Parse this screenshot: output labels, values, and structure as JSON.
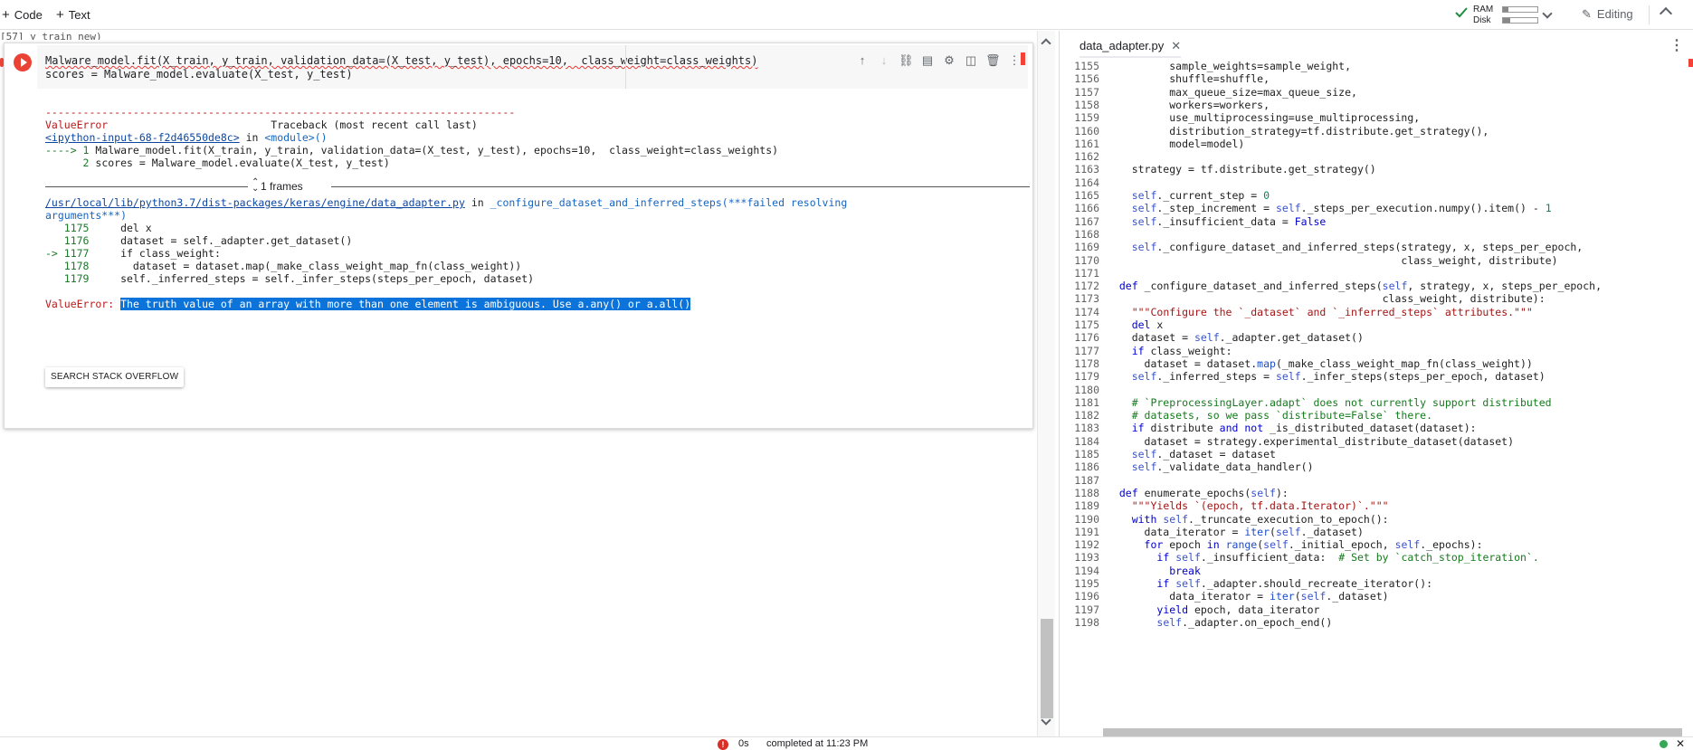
{
  "toolbar": {
    "code_label": "Code",
    "text_label": "Text",
    "ram_label": "RAM",
    "disk_label": "Disk",
    "ram_fill": 0.15,
    "disk_fill": 0.2,
    "editing_label": "Editing"
  },
  "notebook": {
    "prev_cell_fragment": "[57]                                                    y_train_new)",
    "code_lines": [
      "Malware_model.fit(X_train, y_train, validation_data=(X_test, y_test), epochs=10,  class_weight=class_weights)",
      "scores = Malware_model.evaluate(X_test, y_test)"
    ],
    "output": {
      "dashes": "---------------------------------------------------------------------------",
      "error_name": "ValueError",
      "traceback_header": "Traceback (most recent call last)",
      "input_link": "<ipython-input-68-f2d46550de8c>",
      "in_text": " in ",
      "module_text": "<module>()",
      "arrow_line_prefix": "----> 1 ",
      "arrow_line_code": "Malware_model.fit(X_train, y_train, validation_data=(X_test, y_test), epochs=10,  class_weight=class_weights)",
      "line2_prefix": "      2 ",
      "line2_code": "scores = Malware_model.evaluate(X_test, y_test)",
      "frames_label": "1 frames",
      "file_link": "/usr/local/lib/python3.7/dist-packages/keras/engine/data_adapter.py",
      "func_name": "_configure_dataset_and_inferred_steps(***failed resolving",
      "func_name_cont": "arguments***)",
      "frame_lines": [
        {
          "prefix": "   1175 ",
          "code": "    del x"
        },
        {
          "prefix": "   1176 ",
          "code": "    dataset = self._adapter.get_dataset()"
        },
        {
          "prefix": "-> 1177 ",
          "code": "    if class_weight:"
        },
        {
          "prefix": "   1178 ",
          "code": "      dataset = dataset.map(_make_class_weight_map_fn(class_weight))"
        },
        {
          "prefix": "   1179 ",
          "code": "    self._inferred_steps = self._infer_steps(steps_per_epoch, dataset)"
        }
      ],
      "final_error_name": "ValueError:",
      "final_error_msg": "The truth value of an array with more than one element is ambiguous. Use a.any() or a.all()",
      "search_button": "SEARCH STACK OVERFLOW"
    }
  },
  "editor": {
    "tab_title": "data_adapter.py",
    "lines": [
      {
        "n": "1155",
        "t": "          sample_weights=sample_weight,"
      },
      {
        "n": "1156",
        "t": "          shuffle=shuffle,"
      },
      {
        "n": "1157",
        "t": "          max_queue_size=max_queue_size,"
      },
      {
        "n": "1158",
        "t": "          workers=workers,"
      },
      {
        "n": "1159",
        "t": "          use_multiprocessing=use_multiprocessing,"
      },
      {
        "n": "1160",
        "t": "          distribution_strategy=tf.distribute.get_strategy(),"
      },
      {
        "n": "1161",
        "t": "          model=model)"
      },
      {
        "n": "1162",
        "t": ""
      },
      {
        "n": "1163",
        "t": "    strategy = tf.distribute.get_strategy()"
      },
      {
        "n": "1164",
        "t": ""
      },
      {
        "n": "1165",
        "t": "    self._current_step = 0"
      },
      {
        "n": "1166",
        "t": "    self._step_increment = self._steps_per_execution.numpy().item() - 1"
      },
      {
        "n": "1167",
        "t": "    self._insufficient_data = False"
      },
      {
        "n": "1168",
        "t": ""
      },
      {
        "n": "1169",
        "t": "    self._configure_dataset_and_inferred_steps(strategy, x, steps_per_epoch,"
      },
      {
        "n": "1170",
        "t": "                                               class_weight, distribute)"
      },
      {
        "n": "1171",
        "t": ""
      },
      {
        "n": "1172",
        "t": "  def _configure_dataset_and_inferred_steps(self, strategy, x, steps_per_epoch,"
      },
      {
        "n": "1173",
        "t": "                                            class_weight, distribute):"
      },
      {
        "n": "1174",
        "t": "    \"\"\"Configure the `_dataset` and `_inferred_steps` attributes.\"\"\""
      },
      {
        "n": "1175",
        "t": "    del x"
      },
      {
        "n": "1176",
        "t": "    dataset = self._adapter.get_dataset()"
      },
      {
        "n": "1177",
        "t": "    if class_weight:"
      },
      {
        "n": "1178",
        "t": "      dataset = dataset.map(_make_class_weight_map_fn(class_weight))"
      },
      {
        "n": "1179",
        "t": "    self._inferred_steps = self._infer_steps(steps_per_epoch, dataset)"
      },
      {
        "n": "1180",
        "t": ""
      },
      {
        "n": "1181",
        "t": "    # `PreprocessingLayer.adapt` does not currently support distributed"
      },
      {
        "n": "1182",
        "t": "    # datasets, so we pass `distribute=False` there."
      },
      {
        "n": "1183",
        "t": "    if distribute and not _is_distributed_dataset(dataset):"
      },
      {
        "n": "1184",
        "t": "      dataset = strategy.experimental_distribute_dataset(dataset)"
      },
      {
        "n": "1185",
        "t": "    self._dataset = dataset"
      },
      {
        "n": "1186",
        "t": "    self._validate_data_handler()"
      },
      {
        "n": "1187",
        "t": ""
      },
      {
        "n": "1188",
        "t": "  def enumerate_epochs(self):"
      },
      {
        "n": "1189",
        "t": "    \"\"\"Yields `(epoch, tf.data.Iterator)`.\"\"\""
      },
      {
        "n": "1190",
        "t": "    with self._truncate_execution_to_epoch():"
      },
      {
        "n": "1191",
        "t": "      data_iterator = iter(self._dataset)"
      },
      {
        "n": "1192",
        "t": "      for epoch in range(self._initial_epoch, self._epochs):"
      },
      {
        "n": "1193",
        "t": "        if self._insufficient_data:  # Set by `catch_stop_iteration`."
      },
      {
        "n": "1194",
        "t": "          break"
      },
      {
        "n": "1195",
        "t": "        if self._adapter.should_recreate_iterator():"
      },
      {
        "n": "1196",
        "t": "          data_iterator = iter(self._dataset)"
      },
      {
        "n": "1197",
        "t": "        yield epoch, data_iterator"
      },
      {
        "n": "1198",
        "t": "        self._adapter.on_epoch_end()"
      }
    ]
  },
  "status": {
    "time": "0s",
    "completed": "completed at 11:23 PM"
  },
  "colors": {
    "accent_red": "#ea4335",
    "selection_blue": "#0b73d9",
    "status_green": "#34a853"
  }
}
